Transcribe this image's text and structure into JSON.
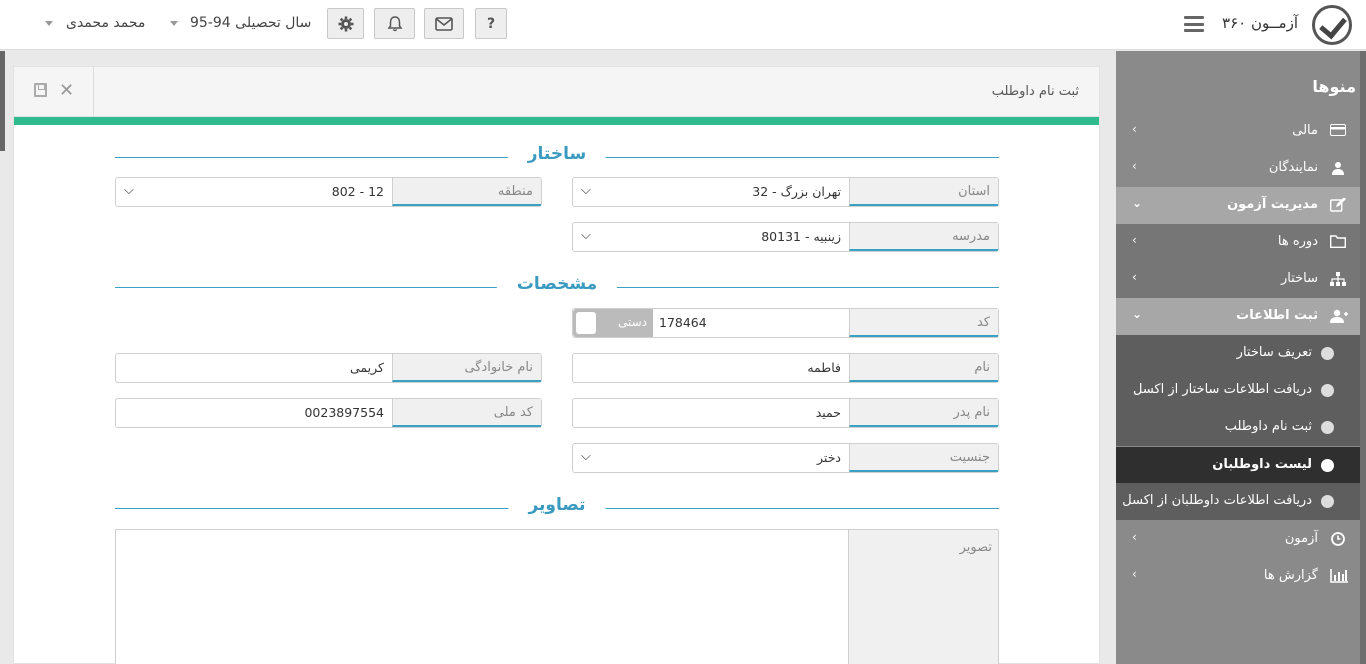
{
  "header": {
    "app_title": "آزمــون ۳۶۰",
    "year_label": "سال تحصیلی 94-95",
    "user_name": "محمد محمدی",
    "help_label": "?"
  },
  "sidebar": {
    "title": "منوها",
    "items": [
      {
        "label": "مالی",
        "icon": "credit-card-icon"
      },
      {
        "label": "نمایندگان",
        "icon": "agent-icon"
      },
      {
        "label": "مدیریت آزمون",
        "icon": "edit-icon"
      },
      {
        "label": "دوره ها",
        "icon": "folder-icon"
      },
      {
        "label": "ساختار",
        "icon": "sitemap-icon"
      },
      {
        "label": "ثبت اطلاعات",
        "icon": "user-plus-icon"
      },
      {
        "label": "آزمون",
        "icon": "clock-icon"
      },
      {
        "label": "گزارش ها",
        "icon": "bar-chart-icon"
      }
    ],
    "sub_items": [
      {
        "label": "تعریف ساختار"
      },
      {
        "label": "دریافت اطلاعات ساختار از اکسل"
      },
      {
        "label": "ثبت نام داوطلب"
      },
      {
        "label": "لیست داوطلبان"
      },
      {
        "label": "دریافت اطلاعات داوطلبان از اکسل"
      }
    ]
  },
  "panel": {
    "title": "ثبت نام داوطلب",
    "sections": {
      "structure": "ساختار",
      "details": "مشخصات",
      "images": "تصاویر"
    },
    "fields": {
      "province": {
        "label": "استان",
        "value": "32 - تهران   بزرگ"
      },
      "region": {
        "label": "منطقه",
        "value": "802 - 12"
      },
      "school": {
        "label": "مدرسه",
        "value": "80131 - زینبیه"
      },
      "code": {
        "label": "کد",
        "value": "178464",
        "toggle": "دستی"
      },
      "first_name": {
        "label": "نام",
        "value": "فاطمه"
      },
      "last_name": {
        "label": "نام خانوادگی",
        "value": "کریمی"
      },
      "father_name": {
        "label": "نام پدر",
        "value": "حمید"
      },
      "national_id": {
        "label": "کد ملی",
        "value": "0023897554"
      },
      "gender": {
        "label": "جنسیت",
        "value": "دختر"
      },
      "photo": {
        "label": "تصویر"
      }
    }
  }
}
